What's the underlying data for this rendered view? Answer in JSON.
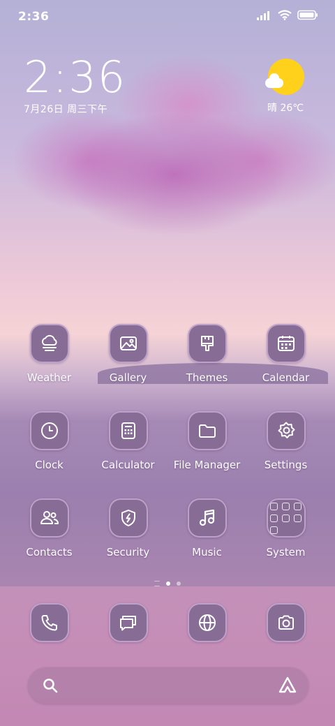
{
  "status_bar": {
    "time": "2:36"
  },
  "clock_widget": {
    "time": "2:36",
    "date": "7月26日 周三下午"
  },
  "weather_widget": {
    "text": "晴 26℃",
    "icon": "sun-cloud-icon"
  },
  "apps": [
    {
      "label": "Weather",
      "icon": "weather-icon"
    },
    {
      "label": "Gallery",
      "icon": "gallery-icon"
    },
    {
      "label": "Themes",
      "icon": "themes-icon"
    },
    {
      "label": "Calendar",
      "icon": "calendar-icon"
    },
    {
      "label": "Clock",
      "icon": "clock-icon"
    },
    {
      "label": "Calculator",
      "icon": "calculator-icon"
    },
    {
      "label": "File Manager",
      "icon": "folder-icon"
    },
    {
      "label": "Settings",
      "icon": "gear-icon"
    },
    {
      "label": "Contacts",
      "icon": "contacts-icon"
    },
    {
      "label": "Security",
      "icon": "shield-icon"
    },
    {
      "label": "Music",
      "icon": "music-icon"
    },
    {
      "label": "System",
      "icon": "system-folder-icon"
    }
  ],
  "dock": [
    {
      "icon": "phone-icon"
    },
    {
      "icon": "messages-icon"
    },
    {
      "icon": "browser-icon"
    },
    {
      "icon": "camera-icon"
    }
  ],
  "page_indicator": {
    "current": 1,
    "pages": 2
  },
  "colors": {
    "icon_bg": "#876c95",
    "icon_border": "#c8aad2",
    "sun": "#ffd11a"
  }
}
